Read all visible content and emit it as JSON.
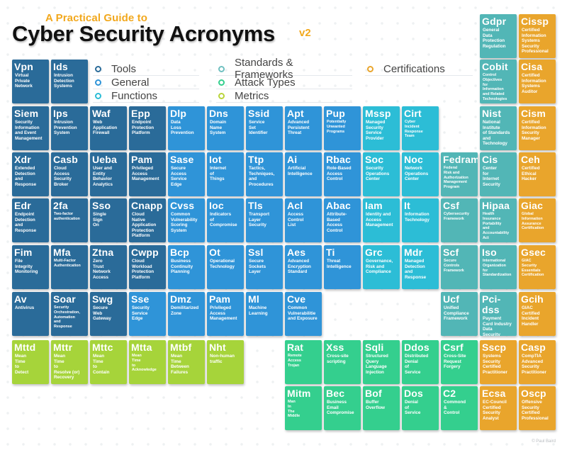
{
  "header": {
    "subtitle": "A Practical Guide to",
    "title": "Cyber Security Acronyms",
    "version": "v2"
  },
  "colors": {
    "tools": "#2a6b99",
    "general": "#2f94d8",
    "functions": "#2cbdd6",
    "standards": "#52b6b6",
    "attack": "#34cf8e",
    "metrics": "#a6d43a",
    "certifications": "#e9a52c"
  },
  "legend": [
    {
      "label": "Tools",
      "category": "tools",
      "color": "#2a6b99"
    },
    {
      "label": "General",
      "category": "general",
      "color": "#2f94d8"
    },
    {
      "label": "Functions",
      "category": "functions",
      "color": "#2cbdd6"
    },
    {
      "label": "Standards & Frameworks",
      "category": "standards",
      "color": "#6fc0c0"
    },
    {
      "label": "Attack Types",
      "category": "attack",
      "color": "#34cf8e"
    },
    {
      "label": "Metrics",
      "category": "metrics",
      "color": "#b9d43a"
    },
    {
      "label": "Certifications",
      "category": "certifications",
      "color": "#e9a52c"
    }
  ],
  "tiles": [
    {
      "abbr": "Gdpr",
      "full": "General\nData\nProtection\nRegulation",
      "category": "standards",
      "col": 12,
      "row": 0
    },
    {
      "abbr": "Cissp",
      "full": "Certified\nInformation\nSystems\nSecurity\nProfessional",
      "category": "certifications",
      "col": 13,
      "row": 0
    },
    {
      "abbr": "Vpn",
      "full": "Virtual\nPrivate\nNetwork",
      "category": "tools",
      "col": 0,
      "row": 1
    },
    {
      "abbr": "Ids",
      "full": "Intrusion\nDetection\nSystems",
      "category": "tools",
      "col": 1,
      "row": 1
    },
    {
      "abbr": "Cobit",
      "full": "Control\nObjectives\nfor\nInformation\nand Related\nTechnologies",
      "category": "standards",
      "col": 12,
      "row": 1,
      "small": true
    },
    {
      "abbr": "Cisa",
      "full": "Certified\nInformation\nSystems\nAuditor",
      "category": "certifications",
      "col": 13,
      "row": 1
    },
    {
      "abbr": "Siem",
      "full": "Security\nInformation\nand Event\nManagement",
      "category": "tools",
      "col": 0,
      "row": 2
    },
    {
      "abbr": "Ips",
      "full": "Intrusion\nPrevention\nSystem",
      "category": "tools",
      "col": 1,
      "row": 2
    },
    {
      "abbr": "Waf",
      "full": "Web\nApplication\nFirewall",
      "category": "tools",
      "col": 2,
      "row": 2
    },
    {
      "abbr": "Epp",
      "full": "Endpoint\nProtection\nPlatform",
      "category": "tools",
      "col": 3,
      "row": 2
    },
    {
      "abbr": "Dlp",
      "full": "Data\nLoss\nPrevention",
      "category": "general",
      "col": 4,
      "row": 2
    },
    {
      "abbr": "Dns",
      "full": "Domain\nName\nSystem",
      "category": "general",
      "col": 5,
      "row": 2
    },
    {
      "abbr": "Ssid",
      "full": "Service\nSet\nIdentifier",
      "category": "general",
      "col": 6,
      "row": 2
    },
    {
      "abbr": "Apt",
      "full": "Advanced\nPersistent\nThreat",
      "category": "general",
      "col": 7,
      "row": 2
    },
    {
      "abbr": "Pup",
      "full": "Potentially\nUnwanted\nPrograms",
      "category": "general",
      "col": 8,
      "row": 2,
      "small": true
    },
    {
      "abbr": "Mssp",
      "full": "Managed\nSecurity\nService\nProvider",
      "category": "functions",
      "col": 9,
      "row": 2
    },
    {
      "abbr": "Cirt",
      "full": "Cyber\nIncident\nResponse\nTeam",
      "category": "functions",
      "col": 10,
      "row": 2,
      "small": true
    },
    {
      "abbr": "Nist",
      "full": "National\nInstitute\nof Standards\nand\nTechnology",
      "category": "standards",
      "col": 12,
      "row": 2
    },
    {
      "abbr": "Cism",
      "full": "Certified\nInformation\nSecurity\nManager",
      "category": "certifications",
      "col": 13,
      "row": 2
    },
    {
      "abbr": "Xdr",
      "full": "Extended\nDetection\nand\nResponse",
      "category": "tools",
      "col": 0,
      "row": 3
    },
    {
      "abbr": "Casb",
      "full": "Cloud\nAccess\nSecurity\nBroker",
      "category": "tools",
      "col": 1,
      "row": 3
    },
    {
      "abbr": "Ueba",
      "full": "User and\nEntity\nBehavior\nAnalytics",
      "category": "tools",
      "col": 2,
      "row": 3
    },
    {
      "abbr": "Pam",
      "full": "Privileged\nAccess\nManagement",
      "category": "tools",
      "col": 3,
      "row": 3
    },
    {
      "abbr": "Sase",
      "full": "Secure\nAccess\nService\nEdge",
      "category": "general",
      "col": 4,
      "row": 3
    },
    {
      "abbr": "Iot",
      "full": "Internet\nof\nThings",
      "category": "general",
      "col": 5,
      "row": 3
    },
    {
      "abbr": "Ttp",
      "full": "Tactics,\nTechniques,\nand\nProcedures",
      "category": "general",
      "col": 6,
      "row": 3
    },
    {
      "abbr": "Ai",
      "full": "Artificial\nIntelligence",
      "category": "general",
      "col": 7,
      "row": 3
    },
    {
      "abbr": "Rbac",
      "full": "Role-Based\nAccess\nControl",
      "category": "general",
      "col": 8,
      "row": 3
    },
    {
      "abbr": "Soc",
      "full": "Security\nOperations\nCenter",
      "category": "functions",
      "col": 9,
      "row": 3
    },
    {
      "abbr": "Noc",
      "full": "Network\nOperations\nCenter",
      "category": "functions",
      "col": 10,
      "row": 3
    },
    {
      "abbr": "Fedramp",
      "full": "Federal\nRisk and\nAuthorization\nManagement\nProgram",
      "category": "standards",
      "col": 11,
      "row": 3,
      "small": true
    },
    {
      "abbr": "Cis",
      "full": "Center\nfor\nInternet\nSecurity",
      "category": "standards",
      "col": 12,
      "row": 3
    },
    {
      "abbr": "Ceh",
      "full": "Certified\nEthical\nHacker",
      "category": "certifications",
      "col": 13,
      "row": 3
    },
    {
      "abbr": "Edr",
      "full": "Endpoint\nDetection\nand\nResponse",
      "category": "tools",
      "col": 0,
      "row": 4
    },
    {
      "abbr": "2fa",
      "full": "Two-factor\nauthentication",
      "category": "tools",
      "col": 1,
      "row": 4,
      "small": true
    },
    {
      "abbr": "Sso",
      "full": "Single\nSign\nOn",
      "category": "tools",
      "col": 2,
      "row": 4
    },
    {
      "abbr": "Cnapp",
      "full": "Cloud\nNative\nApplication\nProtection\nPlatform",
      "category": "tools",
      "col": 3,
      "row": 4
    },
    {
      "abbr": "Cvss",
      "full": "Common\nVulnerability\nScoring\nSystem",
      "category": "general",
      "col": 4,
      "row": 4
    },
    {
      "abbr": "Ioc",
      "full": "Indicators\nof\nCompromise",
      "category": "general",
      "col": 5,
      "row": 4
    },
    {
      "abbr": "Tls",
      "full": "Transport\nLayer\nSecurity",
      "category": "general",
      "col": 6,
      "row": 4
    },
    {
      "abbr": "Acl",
      "full": "Access\nControl\nList",
      "category": "general",
      "col": 7,
      "row": 4
    },
    {
      "abbr": "Abac",
      "full": "Attribute-\nBased\nAccess\nControl",
      "category": "general",
      "col": 8,
      "row": 4
    },
    {
      "abbr": "Iam",
      "full": "Identity and\nAccess\nManagement",
      "category": "functions",
      "col": 9,
      "row": 4
    },
    {
      "abbr": "It",
      "full": "Information\nTechnology",
      "category": "functions",
      "col": 10,
      "row": 4
    },
    {
      "abbr": "Csf",
      "full": "Cybersecurity\nFramework",
      "category": "standards",
      "col": 11,
      "row": 4,
      "small": true
    },
    {
      "abbr": "Hipaa",
      "full": "Health\nInsurance\nPortability\nand\nAccountability\nAct",
      "category": "standards",
      "col": 12,
      "row": 4,
      "small": true
    },
    {
      "abbr": "Giac",
      "full": "Global\nInformation\nAssurance\nCertification",
      "category": "certifications",
      "col": 13,
      "row": 4,
      "small": true
    },
    {
      "abbr": "Fim",
      "full": "File\nIntegrity\nMonitoring",
      "category": "tools",
      "col": 0,
      "row": 5
    },
    {
      "abbr": "Mfa",
      "full": "Multi-Factor\nAuthentication",
      "category": "tools",
      "col": 1,
      "row": 5,
      "small": true
    },
    {
      "abbr": "Ztna",
      "full": "Zero\nTrust\nNetwork\nAccess",
      "category": "tools",
      "col": 2,
      "row": 5
    },
    {
      "abbr": "Cwpp",
      "full": "Cloud\nWorkload\nProtection\nPlatform",
      "category": "tools",
      "col": 3,
      "row": 5
    },
    {
      "abbr": "Bcp",
      "full": "Business\nContinuity\nPlanning",
      "category": "general",
      "col": 4,
      "row": 5
    },
    {
      "abbr": "Ot",
      "full": "Operational\nTechnology",
      "category": "general",
      "col": 5,
      "row": 5
    },
    {
      "abbr": "Ssl",
      "full": "Secure\nSockets\nLayer",
      "category": "general",
      "col": 6,
      "row": 5
    },
    {
      "abbr": "Aes",
      "full": "Advanced\nEncryption\nStandard",
      "category": "general",
      "col": 7,
      "row": 5
    },
    {
      "abbr": "Ti",
      "full": "Threat\nIntelligence",
      "category": "general",
      "col": 8,
      "row": 5
    },
    {
      "abbr": "Grc",
      "full": "Governance,\nRisk and\nCompliance",
      "category": "functions",
      "col": 9,
      "row": 5
    },
    {
      "abbr": "Mdr",
      "full": "Managed\nDetection\nand\nResponse",
      "category": "functions",
      "col": 10,
      "row": 5
    },
    {
      "abbr": "Scf",
      "full": "Secure\nControls\nFramework",
      "category": "standards",
      "col": 11,
      "row": 5,
      "small": true
    },
    {
      "abbr": "Iso",
      "full": "International\nOrganization\nfor\nStandardization",
      "category": "standards",
      "col": 12,
      "row": 5,
      "small": true
    },
    {
      "abbr": "Gsec",
      "full": "GIAC\nSecurity\nEssentials\nCertification",
      "category": "certifications",
      "col": 13,
      "row": 5,
      "small": true
    },
    {
      "abbr": "Av",
      "full": "Antivirus",
      "category": "tools",
      "col": 0,
      "row": 6
    },
    {
      "abbr": "Soar",
      "full": "Security\nOrchestration,\nAutomation\nand\nResponse",
      "category": "tools",
      "col": 1,
      "row": 6,
      "small": true
    },
    {
      "abbr": "Swg",
      "full": "Secure\nWeb\nGateway",
      "category": "tools",
      "col": 2,
      "row": 6
    },
    {
      "abbr": "Sse",
      "full": "Security\nService\nEdge",
      "category": "general",
      "col": 3,
      "row": 6
    },
    {
      "abbr": "Dmz",
      "full": "Demilitarized\nZone",
      "category": "general",
      "col": 4,
      "row": 6
    },
    {
      "abbr": "Pam",
      "full": "Privileged\nAccess\nManagement",
      "category": "general",
      "col": 5,
      "row": 6
    },
    {
      "abbr": "Ml",
      "full": "Machine\nLearning",
      "category": "general",
      "col": 6,
      "row": 6
    },
    {
      "abbr": "Cve",
      "full": "Common\nVulnerabilitie\nand Exposure",
      "category": "general",
      "col": 7,
      "row": 6
    },
    {
      "abbr": "Ucf",
      "full": "Unified\nCompliance\nFramework",
      "category": "standards",
      "col": 11,
      "row": 6
    },
    {
      "abbr": "Pci-dss",
      "full": "Payment\nCard Industry\nData\nSecurity\nStandard",
      "category": "standards",
      "col": 12,
      "row": 6
    },
    {
      "abbr": "Gcih",
      "full": "GIAC\nCertified\nIncident\nHandler",
      "category": "certifications",
      "col": 13,
      "row": 6
    },
    {
      "abbr": "Mttd",
      "full": "Mean\nTime\nto\nDetect",
      "category": "metrics",
      "col": 0,
      "row": 7
    },
    {
      "abbr": "Mttr",
      "full": "Mean\nTime\nto\nResolve (or)\nRecovery",
      "category": "metrics",
      "col": 1,
      "row": 7
    },
    {
      "abbr": "Mttc",
      "full": "Mean\nTime\nto\nContain",
      "category": "metrics",
      "col": 2,
      "row": 7
    },
    {
      "abbr": "Mtta",
      "full": "Mean\nTime\nto\nAcknowledge",
      "category": "metrics",
      "col": 3,
      "row": 7,
      "small": true
    },
    {
      "abbr": "Mtbf",
      "full": "Mean\nTime\nBetween\nFailures",
      "category": "metrics",
      "col": 4,
      "row": 7
    },
    {
      "abbr": "Nht",
      "full": "Non-human\ntraffic",
      "category": "metrics",
      "col": 5,
      "row": 7
    },
    {
      "abbr": "Rat",
      "full": "Remote\nAccess\nTrojan",
      "category": "attack",
      "col": 7,
      "row": 7,
      "small": true
    },
    {
      "abbr": "Xss",
      "full": "Cross-site\nscripting",
      "category": "attack",
      "col": 8,
      "row": 7
    },
    {
      "abbr": "Sqli",
      "full": "Structured\nQuery\nLanguage\nInjection",
      "category": "attack",
      "col": 9,
      "row": 7
    },
    {
      "abbr": "Ddos",
      "full": "Distributed\nDenial\nof\nService",
      "category": "attack",
      "col": 10,
      "row": 7
    },
    {
      "abbr": "Csrf",
      "full": "Cross-Site\nRequest\nForgery",
      "category": "attack",
      "col": 11,
      "row": 7
    },
    {
      "abbr": "Sscp",
      "full": "Systems\nSecurity\nCertified\nPractitioner",
      "category": "certifications",
      "col": 12,
      "row": 7
    },
    {
      "abbr": "Casp",
      "full": "CompTIA\nAdvanced\nSecurity\nPractitioner",
      "category": "certifications",
      "col": 13,
      "row": 7
    },
    {
      "abbr": "Mitm",
      "full": "Man\nIn\nThe\nMiddle",
      "category": "attack",
      "col": 7,
      "row": 8,
      "small": true
    },
    {
      "abbr": "Bec",
      "full": "Business\nEmail\nCompromise",
      "category": "attack",
      "col": 8,
      "row": 8
    },
    {
      "abbr": "Bof",
      "full": "Buffer\nOverflow",
      "category": "attack",
      "col": 9,
      "row": 8
    },
    {
      "abbr": "Dos",
      "full": "Denial\nof\nService",
      "category": "attack",
      "col": 10,
      "row": 8
    },
    {
      "abbr": "C2",
      "full": "Commond\n&\nControl",
      "category": "attack",
      "col": 11,
      "row": 8
    },
    {
      "abbr": "Ecsa",
      "full": "EC-Council\nCertified\nSecurity\nAnalyst",
      "category": "certifications",
      "col": 12,
      "row": 8
    },
    {
      "abbr": "Oscp",
      "full": "Offensive\nSecurity\nCertified\nProfessional",
      "category": "certifications",
      "col": 13,
      "row": 8
    }
  ],
  "footer": {
    "copyright": "© Paul Baird"
  }
}
